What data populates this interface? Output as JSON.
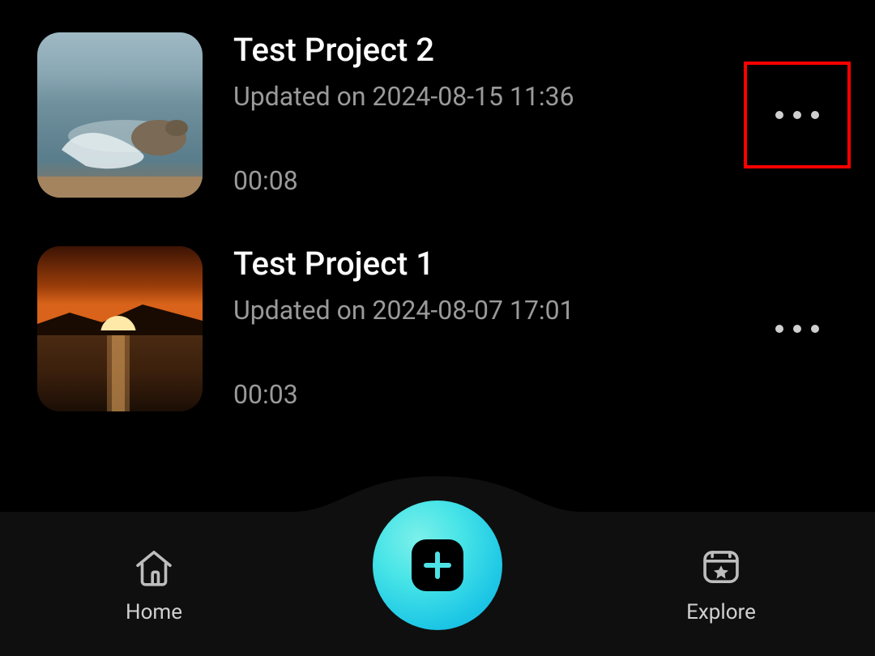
{
  "projects": [
    {
      "title": "Test Project 2",
      "updated": "Updated on 2024-08-15 11:36",
      "duration": "00:08",
      "thumbTheme": "seal"
    },
    {
      "title": "Test Project 1",
      "updated": "Updated on 2024-08-07 17:01",
      "duration": "00:03",
      "thumbTheme": "sunset"
    }
  ],
  "nav": {
    "home_label": "Home",
    "explore_label": "Explore"
  },
  "highlight": {
    "applies_to_project_index": 0
  }
}
